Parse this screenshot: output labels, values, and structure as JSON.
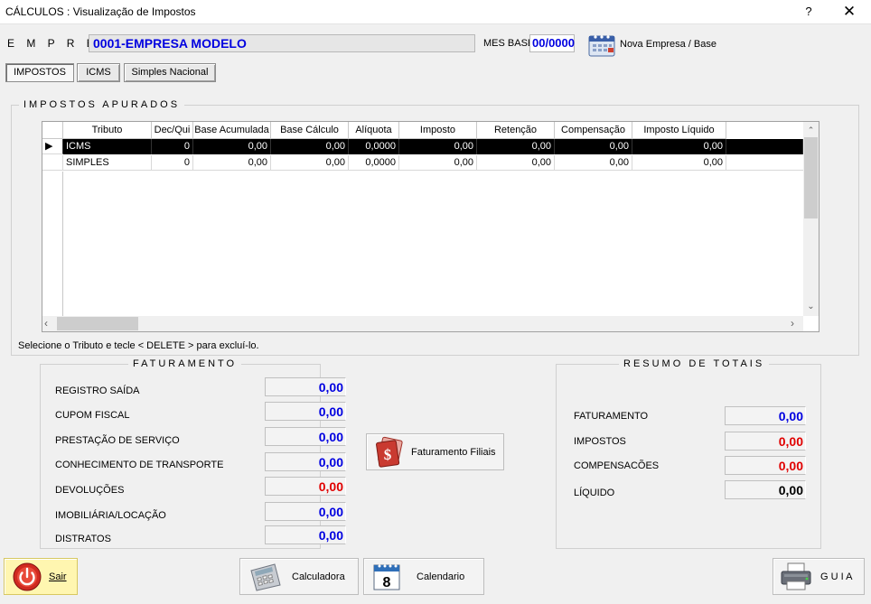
{
  "window": {
    "title": "CÁLCULOS : Visualização de Impostos",
    "help": "?",
    "close": "✕"
  },
  "header": {
    "empresa_label": "E M P R E S A",
    "empresa_value": "0001-EMPRESA MODELO",
    "mes_label": "MES BASE",
    "mes_value": "00/0000",
    "nova_label": "Nova Empresa / Base"
  },
  "tabs": [
    {
      "label": "IMPOSTOS"
    },
    {
      "label": "ICMS"
    },
    {
      "label": "Simples Nacional"
    }
  ],
  "impostos": {
    "title": "IMPOSTOS APURADOS",
    "columns": [
      "Tributo",
      "Dec/Qui",
      "Base Acumulada",
      "Base Cálculo",
      "Alíquota",
      "Imposto",
      "Retenção",
      "Compensação",
      "Imposto Líquido"
    ],
    "rows": [
      [
        "ICMS",
        "0",
        "0,00",
        "0,00",
        "0,0000",
        "0,00",
        "0,00",
        "0,00",
        "0,00"
      ],
      [
        "SIMPLES",
        "0",
        "0,00",
        "0,00",
        "0,0000",
        "0,00",
        "0,00",
        "0,00",
        "0,00"
      ]
    ],
    "hint": "Selecione o Tributo e tecle < DELETE > para excluí-lo."
  },
  "faturamento": {
    "title": "FATURAMENTO",
    "items": [
      {
        "label": "REGISTRO SAÍDA",
        "value": "0,00"
      },
      {
        "label": "CUPOM FISCAL",
        "value": "0,00"
      },
      {
        "label": "PRESTAÇÃO DE SERVIÇO",
        "value": "0,00"
      },
      {
        "label": "CONHECIMENTO DE TRANSPORTE",
        "value": "0,00"
      },
      {
        "label": "DEVOLUÇÕES",
        "value": "0,00"
      },
      {
        "label": "IMOBILIÁRIA/LOCAÇÃO",
        "value": "0,00"
      },
      {
        "label": "DISTRATOS",
        "value": "0,00"
      }
    ]
  },
  "faturamento_filiais": "Faturamento Filiais",
  "resumo": {
    "title": "RESUMO DE TOTAIS",
    "items": [
      {
        "label": "FATURAMENTO",
        "value": "0,00"
      },
      {
        "label": "IMPOSTOS",
        "value": "0,00"
      },
      {
        "label": "COMPENSACÕES",
        "value": "0,00"
      },
      {
        "label": "LÍQUIDO",
        "value": "0,00"
      }
    ]
  },
  "footer": {
    "sair": "Sair",
    "calculadora": "Calculadora",
    "calendario": "Calendario",
    "calendar_day": "8",
    "guia": "G U I A"
  },
  "colors": {
    "value_blue": "#0000e0",
    "value_red": "#e00000",
    "selected_row": "#000000"
  }
}
